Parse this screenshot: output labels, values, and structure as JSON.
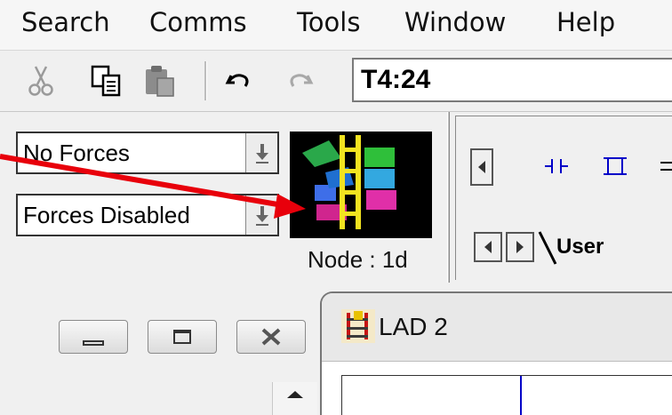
{
  "menu": {
    "items": [
      "Search",
      "Comms",
      "Tools",
      "Window",
      "Help"
    ]
  },
  "toolbar": {
    "icons": [
      "cut-icon",
      "copy-icon",
      "paste-icon",
      "undo-icon",
      "redo-icon"
    ],
    "address_value": "T4:24"
  },
  "forces_panel": {
    "forces_select": "No Forces",
    "forces_enable_select": "Forces Disabled",
    "node_label": "Node :  1d"
  },
  "ladder_panel": {
    "tab_label": "User"
  },
  "child_window": {
    "title": "LAD 2"
  },
  "annotation": {
    "arrow_color": "#e8000b"
  }
}
